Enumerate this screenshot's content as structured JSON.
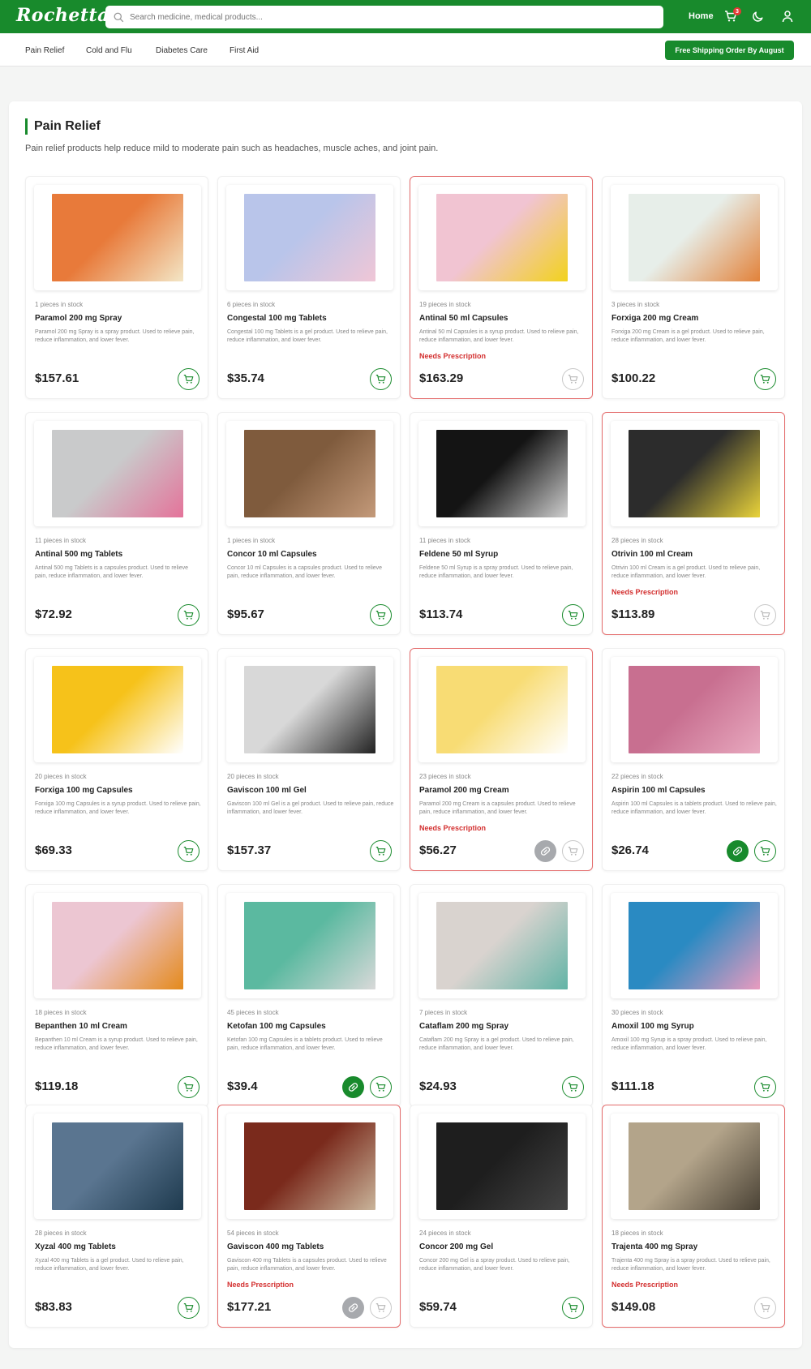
{
  "app": {
    "logo": "Rochetta",
    "accent": "#188a2c",
    "rx_color": "#d32f2f"
  },
  "header": {
    "search_placeholder": "Search medicine, medical products...",
    "home_label": "Home",
    "cart_count": "3",
    "icons": [
      "search-icon",
      "cart-icon",
      "moon-icon",
      "user-icon"
    ]
  },
  "subnav": {
    "categories": [
      "Pain Relief",
      "Cold and Flu",
      "Diabetes Care",
      "First Aid"
    ],
    "shipping_label": "Free Shipping Order By August"
  },
  "section": {
    "title": "Pain Relief",
    "description": "Pain relief products help reduce mild to moderate pain such as headaches, muscle aches, and joint pain."
  },
  "products": [
    {
      "stock": "1 pieces in stock",
      "name": "Paramol 200 mg Spray",
      "desc": "Paramol 200 mg Spray is a spray product. Used to relieve pain, reduce inflammation, and lower fever.",
      "rx": "",
      "price": "$157.61",
      "pill": "",
      "cart": "enabled",
      "image_colors": [
        "#e87a3a",
        "#f3e6c6"
      ]
    },
    {
      "stock": "6 pieces in stock",
      "name": "Congestal 100 mg Tablets",
      "desc": "Congestal 100 mg Tablets is a gel product. Used to relieve pain, reduce inflammation, and lower fever.",
      "rx": "",
      "price": "$35.74",
      "pill": "",
      "cart": "enabled",
      "image_colors": [
        "#b9c5ea",
        "#f0c6d6"
      ]
    },
    {
      "stock": "19 pieces in stock",
      "name": "Antinal 50 ml Capsules",
      "desc": "Antinal 50 ml Capsules is a syrup product. Used to relieve pain, reduce inflammation, and lower fever.",
      "rx": "Needs Prescription",
      "price": "$163.29",
      "pill": "",
      "cart": "disabled",
      "image_colors": [
        "#f1c4d2",
        "#f2d21c"
      ]
    },
    {
      "stock": "3 pieces in stock",
      "name": "Forxiga 200 mg Cream",
      "desc": "Forxiga 200 mg Cream is a gel product. Used to relieve pain, reduce inflammation, and lower fever.",
      "rx": "",
      "price": "$100.22",
      "pill": "",
      "cart": "enabled",
      "image_colors": [
        "#e7eee9",
        "#e2823a"
      ]
    },
    {
      "stock": "11 pieces in stock",
      "name": "Antinal 500 mg Tablets",
      "desc": "Antinal 500 mg Tablets is a capsules product. Used to relieve pain, reduce inflammation, and lower fever.",
      "rx": "",
      "price": "$72.92",
      "pill": "",
      "cart": "enabled",
      "image_colors": [
        "#c9cacb",
        "#e4739a"
      ]
    },
    {
      "stock": "1 pieces in stock",
      "name": "Concor 10 ml Capsules",
      "desc": "Concor 10 ml Capsules is a capsules product. Used to relieve pain, reduce inflammation, and lower fever.",
      "rx": "",
      "price": "$95.67",
      "pill": "",
      "cart": "enabled",
      "image_colors": [
        "#7f5b3d",
        "#c49a7a"
      ]
    },
    {
      "stock": "11 pieces in stock",
      "name": "Feldene 50 ml Syrup",
      "desc": "Feldene 50 ml Syrup is a spray product. Used to relieve pain, reduce inflammation, and lower fever.",
      "rx": "",
      "price": "$113.74",
      "pill": "",
      "cart": "enabled",
      "image_colors": [
        "#141414",
        "#cfcfcf"
      ]
    },
    {
      "stock": "28 pieces in stock",
      "name": "Otrivin 100 ml Cream",
      "desc": "Otrivin 100 ml Cream is a gel product. Used to relieve pain, reduce inflammation, and lower fever.",
      "rx": "Needs Prescription",
      "price": "$113.89",
      "pill": "",
      "cart": "disabled",
      "image_colors": [
        "#2c2c2c",
        "#e9d33a"
      ]
    },
    {
      "stock": "20 pieces in stock",
      "name": "Forxiga 100 mg Capsules",
      "desc": "Forxiga 100 mg Capsules is a syrup product. Used to relieve pain, reduce inflammation, and lower fever.",
      "rx": "",
      "price": "$69.33",
      "pill": "",
      "cart": "enabled",
      "image_colors": [
        "#f6c21a",
        "#ffffff"
      ]
    },
    {
      "stock": "20 pieces in stock",
      "name": "Gaviscon 100 ml Gel",
      "desc": "Gaviscon 100 ml Gel is a gel product. Used to relieve pain, reduce inflammation, and lower fever.",
      "rx": "",
      "price": "$157.37",
      "pill": "",
      "cart": "enabled",
      "image_colors": [
        "#d8d8d8",
        "#222222"
      ]
    },
    {
      "stock": "23 pieces in stock",
      "name": "Paramol 200 mg Cream",
      "desc": "Paramol 200 mg Cream is a capsules product. Used to relieve pain, reduce inflammation, and lower fever.",
      "rx": "Needs Prescription",
      "price": "$56.27",
      "pill": "disabled",
      "cart": "disabled",
      "image_colors": [
        "#f8dc74",
        "#ffffff"
      ]
    },
    {
      "stock": "22 pieces in stock",
      "name": "Aspirin 100 ml Capsules",
      "desc": "Aspirin 100 ml Capsules is a tablets product. Used to relieve pain, reduce inflammation, and lower fever.",
      "rx": "",
      "price": "$26.74",
      "pill": "enabled",
      "cart": "enabled",
      "image_colors": [
        "#c86f90",
        "#e8a9bf"
      ]
    },
    {
      "stock": "18 pieces in stock",
      "name": "Bepanthen 10 ml Cream",
      "desc": "Bepanthen 10 ml Cream is a syrup product. Used to relieve pain, reduce inflammation, and lower fever.",
      "rx": "",
      "price": "$119.18",
      "pill": "",
      "cart": "enabled",
      "image_colors": [
        "#ecc6d2",
        "#e48a1c"
      ]
    },
    {
      "stock": "45 pieces in stock",
      "name": "Ketofan 100 mg Capsules",
      "desc": "Ketofan 100 mg Capsules is a tablets product. Used to relieve pain, reduce inflammation, and lower fever.",
      "rx": "",
      "price": "$39.4",
      "pill": "enabled",
      "cart": "enabled",
      "image_colors": [
        "#5bb9a0",
        "#d9d9d9"
      ]
    },
    {
      "stock": "7 pieces in stock",
      "name": "Cataflam 200 mg Spray",
      "desc": "Cataflam 200 mg Spray is a gel product. Used to relieve pain, reduce inflammation, and lower fever.",
      "rx": "",
      "price": "$24.93",
      "pill": "",
      "cart": "enabled",
      "image_colors": [
        "#d9d3cf",
        "#62b4a6"
      ]
    },
    {
      "stock": "30 pieces in stock",
      "name": "Amoxil 100 mg Syrup",
      "desc": "Amoxil 100 mg Syrup is a spray product. Used to relieve pain, reduce inflammation, and lower fever.",
      "rx": "",
      "price": "$111.18",
      "pill": "",
      "cart": "enabled",
      "image_colors": [
        "#2a8ac2",
        "#e99bbf"
      ]
    },
    {
      "stock": "28 pieces in stock",
      "name": "Xyzal 400 mg Tablets",
      "desc": "Xyzal 400 mg Tablets is a gel product. Used to relieve pain, reduce inflammation, and lower fever.",
      "rx": "",
      "price": "$83.83",
      "pill": "",
      "cart": "enabled",
      "image_colors": [
        "#5a7590",
        "#1f3b4f"
      ]
    },
    {
      "stock": "54 pieces in stock",
      "name": "Gaviscon 400 mg Tablets",
      "desc": "Gaviscon 400 mg Tablets is a capsules product. Used to relieve pain, reduce inflammation, and lower fever.",
      "rx": "Needs Prescription",
      "price": "$177.21",
      "pill": "disabled",
      "cart": "disabled",
      "image_colors": [
        "#7a2a1c",
        "#c9b49a"
      ]
    },
    {
      "stock": "24 pieces in stock",
      "name": "Concor 200 mg Gel",
      "desc": "Concor 200 mg Gel is a spray product. Used to relieve pain, reduce inflammation, and lower fever.",
      "rx": "",
      "price": "$59.74",
      "pill": "",
      "cart": "enabled",
      "image_colors": [
        "#1e1e1e",
        "#444444"
      ]
    },
    {
      "stock": "18 pieces in stock",
      "name": "Trajenta 400 mg Spray",
      "desc": "Trajenta 400 mg Spray is a spray product. Used to relieve pain, reduce inflammation, and lower fever.",
      "rx": "Needs Prescription",
      "price": "$149.08",
      "pill": "",
      "cart": "disabled",
      "image_colors": [
        "#b3a48a",
        "#4b4336"
      ]
    }
  ]
}
